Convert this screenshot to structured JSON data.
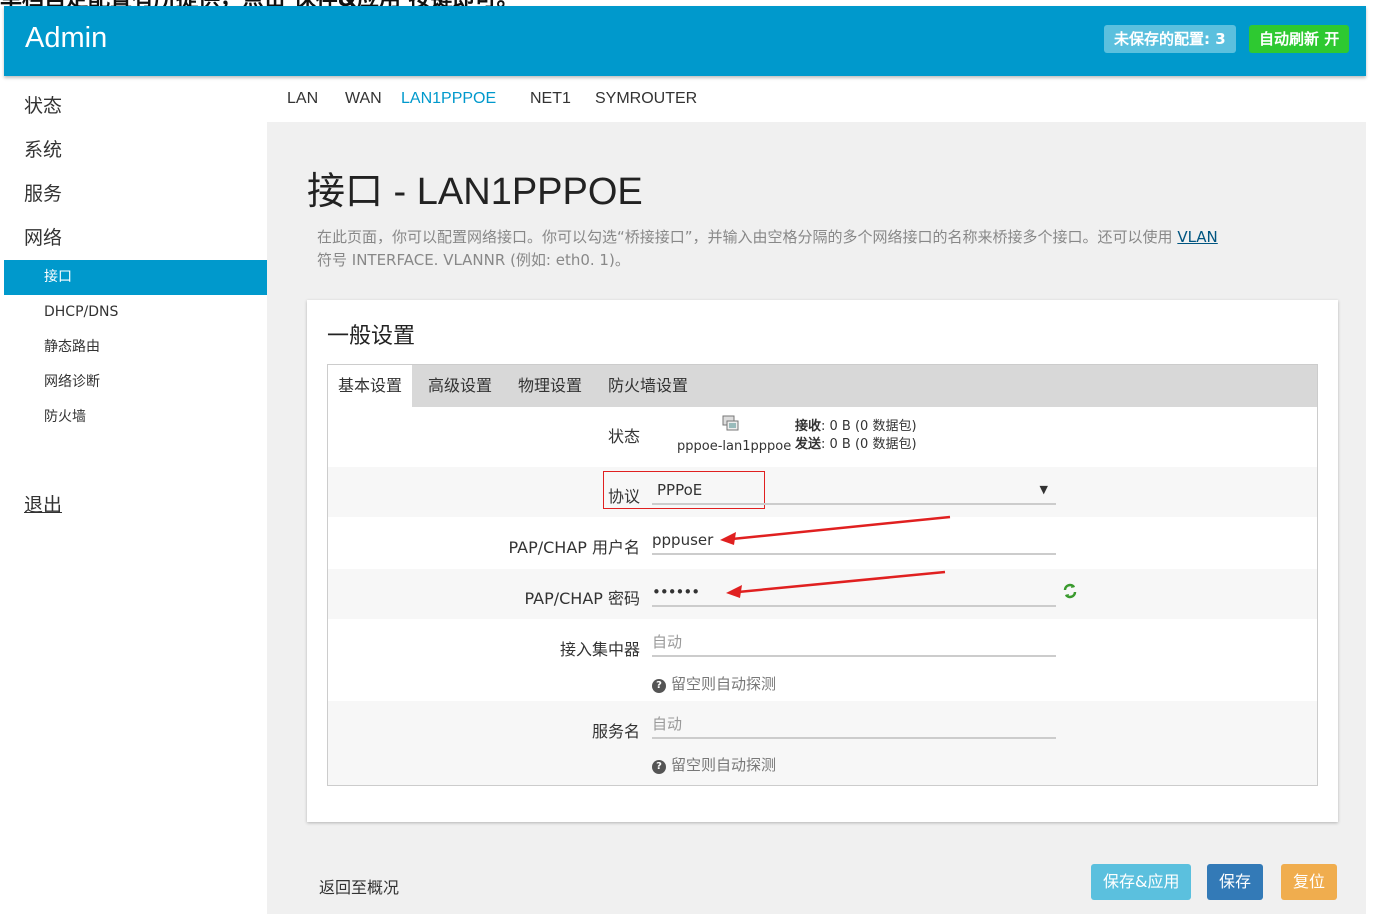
{
  "caption": "单档自定配置有所提供，点击 保存&应用 按键即可。",
  "header": {
    "brand": "Admin",
    "unsaved_label": "未保存的配置: 3",
    "autorefresh_label": "自动刷新 开"
  },
  "sidebar": {
    "top_items": [
      {
        "label": "状态"
      },
      {
        "label": "系统"
      },
      {
        "label": "服务"
      },
      {
        "label": "网络"
      }
    ],
    "sub_items": [
      {
        "label": "接口",
        "active": true
      },
      {
        "label": "DHCP/DNS"
      },
      {
        "label": "静态路由"
      },
      {
        "label": "网络诊断"
      },
      {
        "label": "防火墙"
      }
    ],
    "logout": "退出"
  },
  "tabs": [
    {
      "label": "LAN"
    },
    {
      "label": "WAN"
    },
    {
      "label": "LAN1PPPOE",
      "active": true
    },
    {
      "label": "NET1"
    },
    {
      "label": "SYMROUTER"
    }
  ],
  "page": {
    "title": "接口 - LAN1PPPOE",
    "desc_1": "在此页面，你可以配置网络接口。你可以勾选“桥接接口”，并输入由空格分隔的多个网络接口的名称来桥接多个接口。还可以使用 ",
    "desc_link": "VLAN",
    "desc_2": "符号 INTERFACE. VLANNR (例如: eth0. 1)。"
  },
  "card": {
    "title": "一般设置",
    "subtabs": [
      {
        "label": "基本设置",
        "active": true
      },
      {
        "label": "高级设置"
      },
      {
        "label": "物理设置"
      },
      {
        "label": "防火墙设置"
      }
    ],
    "status": {
      "label": "状态",
      "device": "pppoe-lan1pppoe",
      "rx_label": "接收",
      "rx_value": ": 0 B (0 数据包)",
      "tx_label": "发送",
      "tx_value": ": 0 B (0 数据包)"
    },
    "protocol": {
      "label": "协议",
      "value": "PPPoE"
    },
    "username": {
      "label": "PAP/CHAP 用户名",
      "value": "pppuser"
    },
    "password": {
      "label": "PAP/CHAP 密码",
      "value": "••••••"
    },
    "concentrator": {
      "label": "接入集中器",
      "placeholder": "自动",
      "hint": "留空则自动探测"
    },
    "service": {
      "label": "服务名",
      "placeholder": "自动",
      "hint": "留空则自动探测"
    }
  },
  "footer": {
    "back": "返回至概况",
    "apply": "保存&应用",
    "save": "保存",
    "reset": "复位"
  },
  "colors": {
    "primary": "#0099cc",
    "success": "#2ec931",
    "info": "#5bc0de",
    "save": "#337ab7",
    "warning": "#f0ad4e",
    "annotation": "#e02020"
  }
}
